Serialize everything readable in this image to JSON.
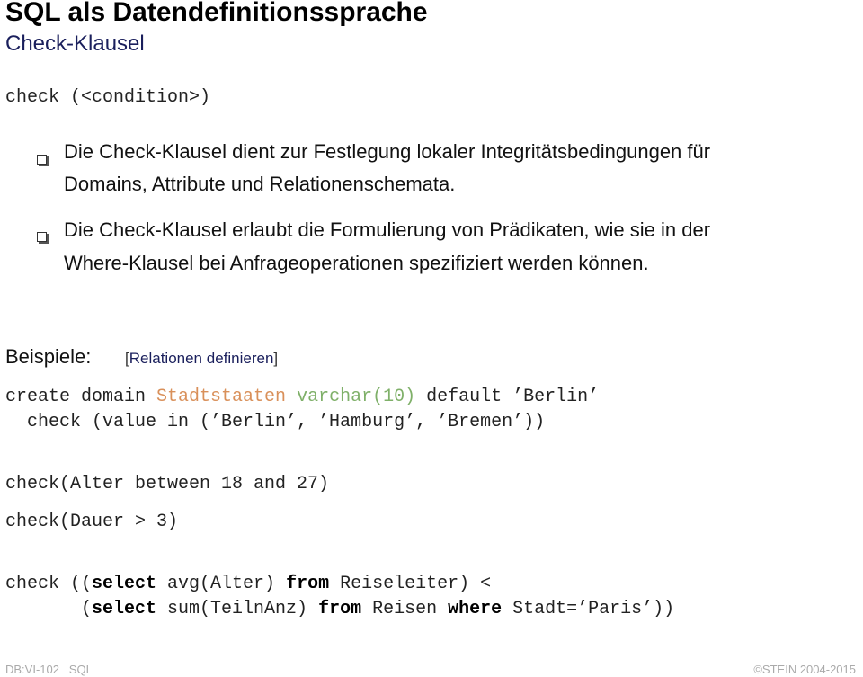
{
  "header": {
    "title": "SQL als Datendefinitionssprache",
    "subtitle": "Check-Klausel"
  },
  "syntax": "check (<condition>)",
  "bullets": [
    {
      "line1": "Die Check-Klausel dient zur Festlegung lokaler Integritätsbedingungen für",
      "line2": "Domains, Attribute und Relationenschemata."
    },
    {
      "line1": "Die Check-Klausel erlaubt die Formulierung von Prädikaten, wie sie in der",
      "line2": "Where-Klausel bei Anfrageoperationen spezifiziert werden können."
    }
  ],
  "examples": {
    "label": "Beispiele:",
    "link_open": "[",
    "link_text": "Relationen definieren",
    "link_close": "]",
    "code1": {
      "line1_prefix": "create domain ",
      "line1_name": "Stadtstaaten",
      "line1_type": "varchar(10)",
      "line1_suffix": " default ’Berlin’",
      "line2": "  check (value in (’Berlin’, ’Hamburg’, ’Bremen’))"
    },
    "code2": "check(Alter between 18 and 27)",
    "code3": "check(Dauer > 3)",
    "code4": {
      "l1_a": "check ((",
      "l1_kw1": "select",
      "l1_b": " avg(Alter) ",
      "l1_kw2": "from",
      "l1_c": " Reiseleiter) <",
      "l2_a": "       (",
      "l2_kw1": "select",
      "l2_b": " sum(TeilnAnz) ",
      "l2_kw2": "from",
      "l2_c": " Reisen ",
      "l2_kw3": "where",
      "l2_d": " Stadt=’Paris’))"
    }
  },
  "footer": {
    "left": "DB:VI-102   SQL",
    "right": "©STEIN 2004-2015"
  },
  "colors": {
    "subtitle": "#1a1f5c",
    "domain_name": "#d9905a",
    "type_name": "#7fb069"
  }
}
